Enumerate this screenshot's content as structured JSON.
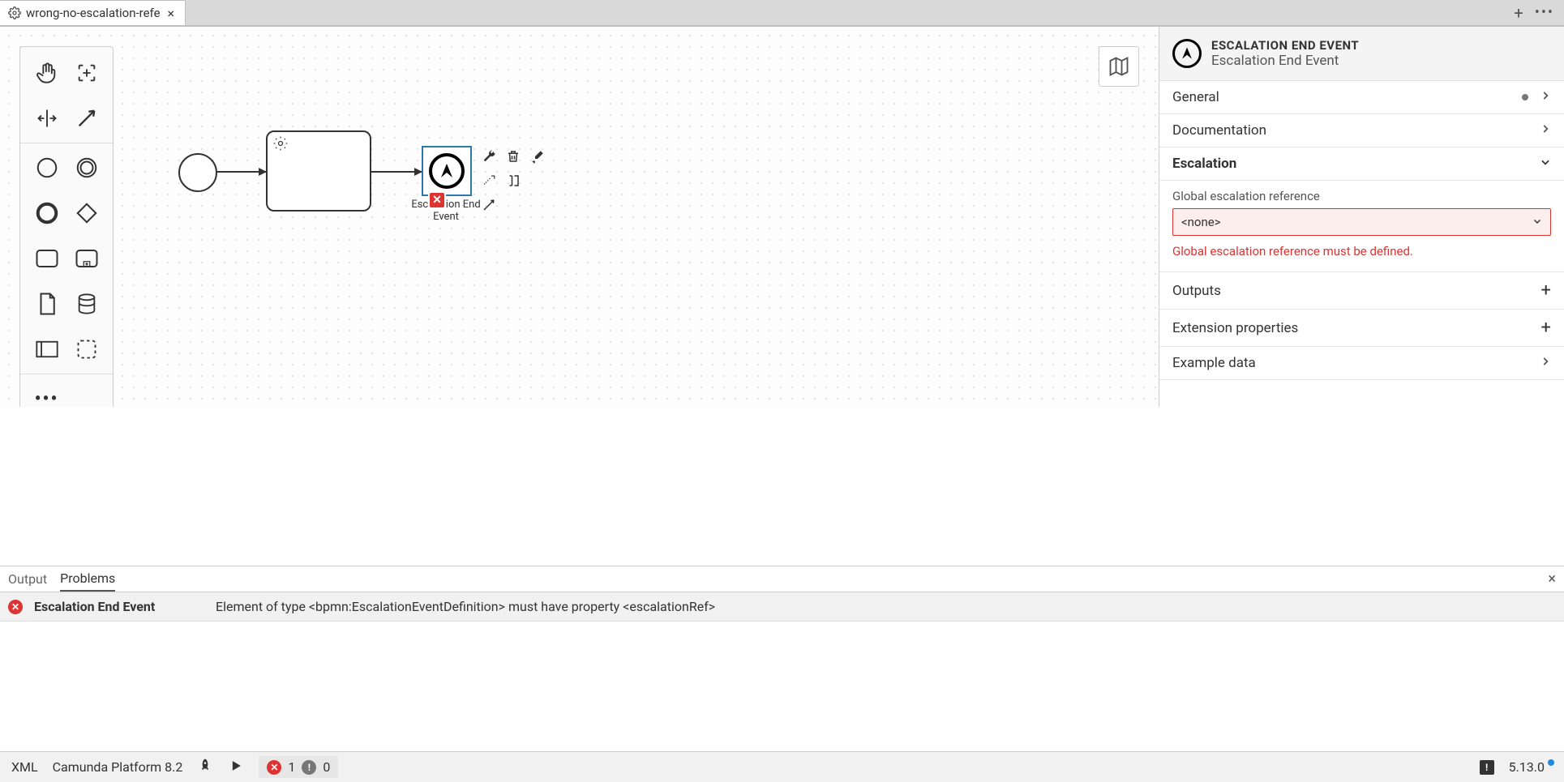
{
  "tab": {
    "title": "wrong-no-escalation-refe",
    "close": "×"
  },
  "diagram": {
    "end_event_label": "Escalation End Event"
  },
  "props": {
    "header_type": "ESCALATION END EVENT",
    "header_name": "Escalation End Event",
    "sections": {
      "general": "General",
      "documentation": "Documentation",
      "escalation": "Escalation",
      "outputs": "Outputs",
      "extension": "Extension properties",
      "example": "Example data"
    },
    "escalation_group": {
      "label": "Global escalation reference",
      "value": "<none>",
      "error": "Global escalation reference must be defined."
    }
  },
  "bottom": {
    "tab_output": "Output",
    "tab_problems": "Problems",
    "close": "×",
    "row": {
      "title": "Escalation End Event",
      "message": "Element of type <bpmn:EscalationEventDefinition> must have property <escalationRef>"
    }
  },
  "status": {
    "xml": "XML",
    "platform": "Camunda Platform 8.2",
    "errors": "1",
    "warnings": "0",
    "version": "5.13.0"
  }
}
